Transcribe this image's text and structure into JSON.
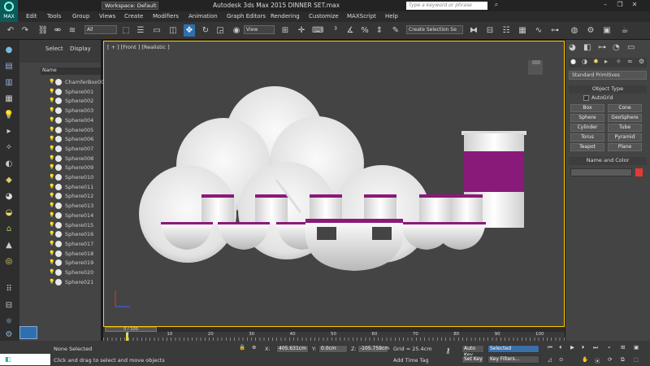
{
  "app": {
    "title": "Autodesk 3ds Max  2015    DINNER SET.max",
    "logo_label": "MAX",
    "workspace": "Workspace: Default",
    "search_placeholder": "Type a keyword or phrase"
  },
  "menu": [
    "Edit",
    "Tools",
    "Group",
    "Views",
    "Create",
    "Modifiers",
    "Animation",
    "Graph Editors",
    "Rendering",
    "Customize",
    "MAXScript",
    "Help"
  ],
  "toolbar": {
    "filter": "All",
    "ref_coord": "View",
    "selection_set": "Create Selection Se"
  },
  "scene_explorer": {
    "tabs": [
      "Select",
      "Display"
    ],
    "column_header": "Name",
    "items": [
      "ChamferBox00",
      "Sphere001",
      "Sphere002",
      "Sphere003",
      "Sphere004",
      "Sphere005",
      "Sphere006",
      "Sphere007",
      "Sphere008",
      "Sphere009",
      "Sphere010",
      "Sphere011",
      "Sphere012",
      "Sphere013",
      "Sphere014",
      "Sphere015",
      "Sphere016",
      "Sphere017",
      "Sphere018",
      "Sphere019",
      "Sphere020",
      "Sphere021"
    ]
  },
  "viewport": {
    "label": "[ + ] [Front ] [Realistic ]"
  },
  "command_panel": {
    "dropdown": "Standard Primitives",
    "object_type_header": "Object Type",
    "autogrid": "AutoGrid",
    "buttons": [
      "Box",
      "Cone",
      "Sphere",
      "GeoSphere",
      "Cylinder",
      "Tube",
      "Torus",
      "Pyramid",
      "Teapot",
      "Plane"
    ],
    "name_color_header": "Name and Color",
    "swatch_color": "#e53935"
  },
  "timeline": {
    "frame_label": "0 / 100",
    "ticks": [
      "0",
      "10",
      "20",
      "30",
      "40",
      "50",
      "60",
      "70",
      "80",
      "90",
      "100"
    ]
  },
  "status": {
    "selection": "None Selected",
    "prompt": "Click and drag to select and move objects",
    "x": "405.631cm",
    "y": "0.0cm",
    "z": "-105.759cm",
    "grid": "Grid = 25.4cm",
    "add_time_tag": "Add Time Tag",
    "auto_key": "Auto Key",
    "set_key": "Set Key",
    "key_mode": "Selected",
    "key_filters": "Key Filters..."
  }
}
